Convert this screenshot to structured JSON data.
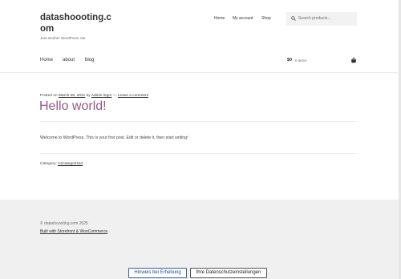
{
  "site": {
    "title": "datashoooting.com",
    "tagline": "Just another WordPress site"
  },
  "top_nav": [
    "Home",
    "My account",
    "Shop"
  ],
  "search": {
    "placeholder": "Search products…"
  },
  "main_nav": [
    "Home",
    "about",
    "blog"
  ],
  "cart": {
    "amount": "$0",
    "items": "0 items"
  },
  "post": {
    "meta_prefix": "Posted on",
    "date": "March 28, 2021",
    "by": "by",
    "author": "Admin lngor",
    "dash": "—",
    "comment_link": "Leave a comment",
    "title": "Hello world!",
    "body": "Welcome to WordPress. This is your first post. Edit or delete it, then start writing!",
    "category_prefix": "Category:",
    "category": "Uncategorized"
  },
  "footer": {
    "copyright": "© datashoooting.com 2025",
    "built_with": "Built with Storefront & WooCommerce",
    "built_suffix": "."
  },
  "consent": {
    "primary": "Hinweis bei Erhebung",
    "secondary": "Ihre Datenschutzeinstellungen"
  },
  "colors": {
    "accent": "#96588a",
    "footer_bg": "#f0f0f0",
    "search_bg": "#f2f2f2"
  },
  "icons": {
    "search": "search-icon",
    "cart": "basket-icon"
  }
}
